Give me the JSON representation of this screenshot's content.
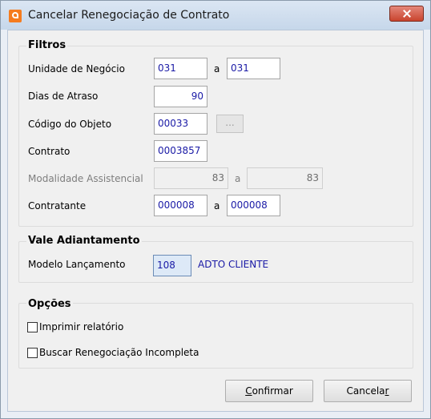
{
  "window": {
    "title": "Cancelar Renegociação de Contrato"
  },
  "filtros": {
    "title": "Filtros",
    "unidade": {
      "label": "Unidade de Negócio",
      "from": "031",
      "sep": "a",
      "to": "031"
    },
    "dias": {
      "label": "Dias de Atraso",
      "value": "90"
    },
    "codigo": {
      "label": "Código do Objeto",
      "value": "00033",
      "button": "..."
    },
    "contrato": {
      "label": "Contrato",
      "value": "0003857"
    },
    "modalidade": {
      "label": "Modalidade Assistencial",
      "from": "83",
      "sep": "a",
      "to": "83"
    },
    "contratante": {
      "label": "Contratante",
      "from": "000008",
      "sep": "a",
      "to": "000008"
    }
  },
  "vale": {
    "title": "Vale Adiantamento",
    "modelo": {
      "label": "Modelo Lançamento",
      "code": "108",
      "description": "ADTO CLIENTE"
    }
  },
  "opcoes": {
    "title": "Opções",
    "imprimir": {
      "label": "Imprimir relatório",
      "checked": false
    },
    "buscar": {
      "label": "Buscar Renegociação Incompleta",
      "checked": false
    }
  },
  "buttons": {
    "confirm": {
      "ul": "C",
      "rest": "onfirmar"
    },
    "cancel": {
      "pre": "Cancela",
      "ul": "r"
    }
  },
  "colors": {
    "field_text": "#1a1aa6",
    "close": "#c9442e",
    "accent": "#f57c1f"
  }
}
